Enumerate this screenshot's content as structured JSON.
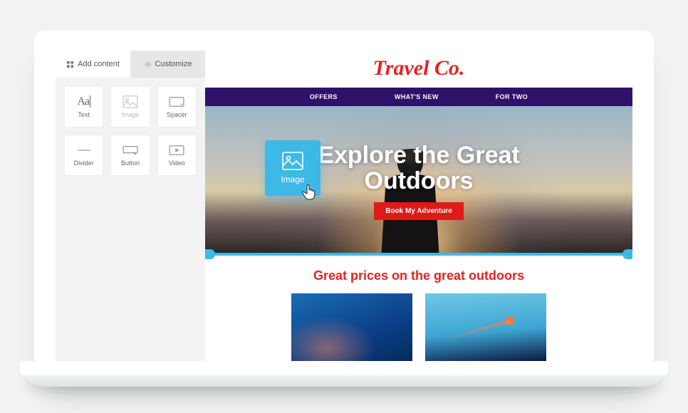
{
  "panel": {
    "tabs": {
      "add": "Add content",
      "customize": "Customize"
    },
    "blocks": [
      {
        "id": "text",
        "label": "Text",
        "icon": "text-icon"
      },
      {
        "id": "image",
        "label": "Image",
        "icon": "image-icon"
      },
      {
        "id": "spacer",
        "label": "Spacer",
        "icon": "spacer-icon"
      },
      {
        "id": "divider",
        "label": "Divider",
        "icon": "divider-icon"
      },
      {
        "id": "button",
        "label": "Button",
        "icon": "button-icon"
      },
      {
        "id": "video",
        "label": "Video",
        "icon": "video-icon"
      }
    ]
  },
  "drag": {
    "label": "Image"
  },
  "site": {
    "brand": "Travel Co.",
    "nav": [
      "OFFERS",
      "WHAT'S NEW",
      "FOR TWO"
    ],
    "hero": {
      "title_line1": "Explore the Great",
      "title_line2": "Outdoors",
      "cta": "Book My Adventure"
    },
    "section_title": "Great prices on the great outdoors"
  }
}
